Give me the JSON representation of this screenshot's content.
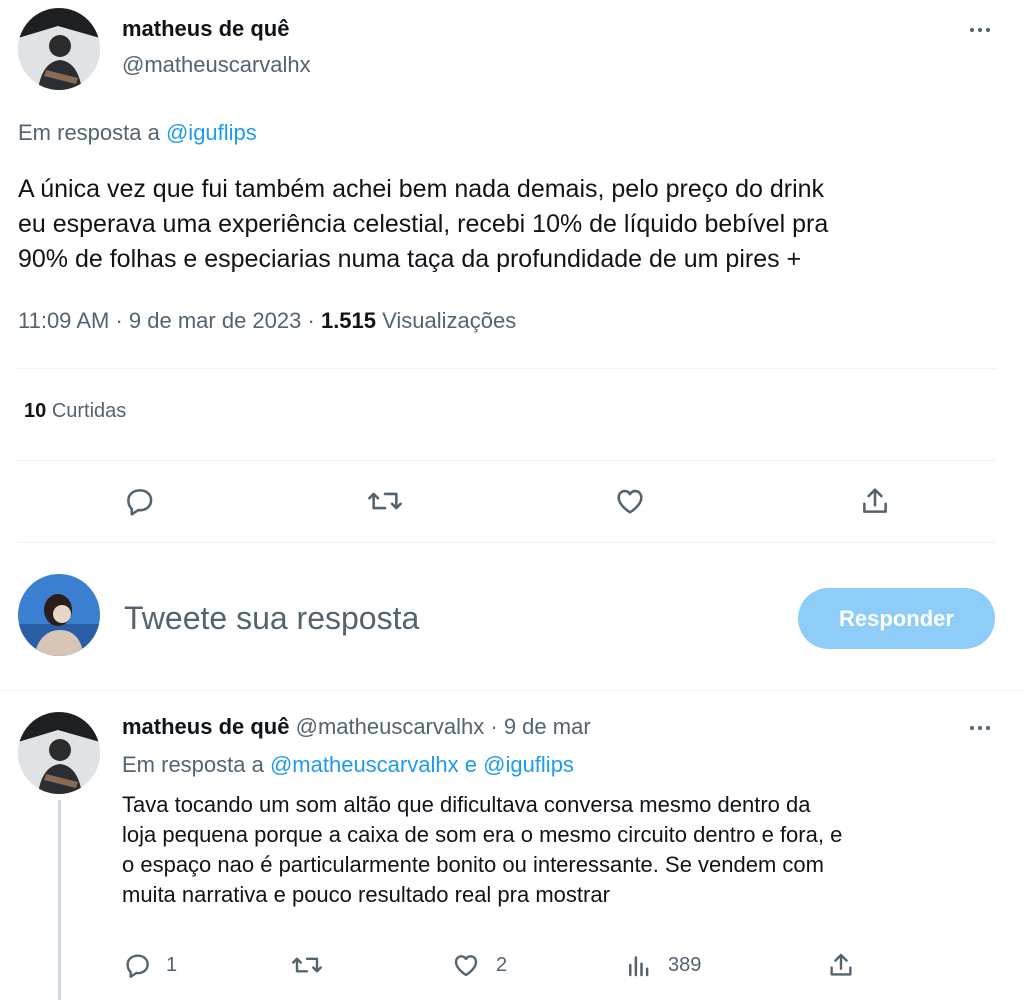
{
  "main_tweet": {
    "author_name": "matheus de quê",
    "author_handle": "@matheuscarvalhx",
    "reply_prefix": "Em resposta a",
    "reply_to": "@iguflips",
    "text_lines": [
      "A única vez que fui também achei bem nada demais, pelo preço do drink",
      "eu esperava uma experiência celestial, recebi 10% de líquido bebível pra",
      "90% de folhas e especiarias numa taça da profundidade de um pires +"
    ],
    "time": "11:09 AM",
    "date": "9 de mar de 2023",
    "views_count": "1.515",
    "views_label": "Visualizações",
    "likes_count": "10",
    "likes_label": "Curtidas"
  },
  "compose": {
    "placeholder": "Tweete sua resposta",
    "button_label": "Responder"
  },
  "reply_tweet": {
    "author_name": "matheus de quê",
    "author_handle": "@matheuscarvalhx",
    "date": "9 de mar",
    "reply_prefix": "Em resposta a",
    "reply_to_1": "@matheuscarvalhx",
    "reply_conjunction": "e",
    "reply_to_2": "@iguflips",
    "text_lines": [
      "Tava tocando um som altão que dificultava conversa mesmo dentro da",
      "loja pequena porque a caixa de som era o mesmo circuito dentro e fora, e",
      "o espaço nao é particularmente bonito ou interessante. Se vendem com",
      "muita narrativa e pouco resultado real pra mostrar"
    ],
    "reply_count": "1",
    "like_count": "2",
    "views_count": "389"
  },
  "icons": {
    "more": "more-horizontal-icon",
    "reply": "reply-icon",
    "retweet": "retweet-icon",
    "like": "heart-icon",
    "share": "share-icon",
    "views": "views-icon"
  },
  "colors": {
    "text": "#0f1419",
    "secondary": "#536471",
    "link": "#1d9bf0",
    "button_disabled": "#8ecdf8",
    "divider": "#eff3f4"
  }
}
